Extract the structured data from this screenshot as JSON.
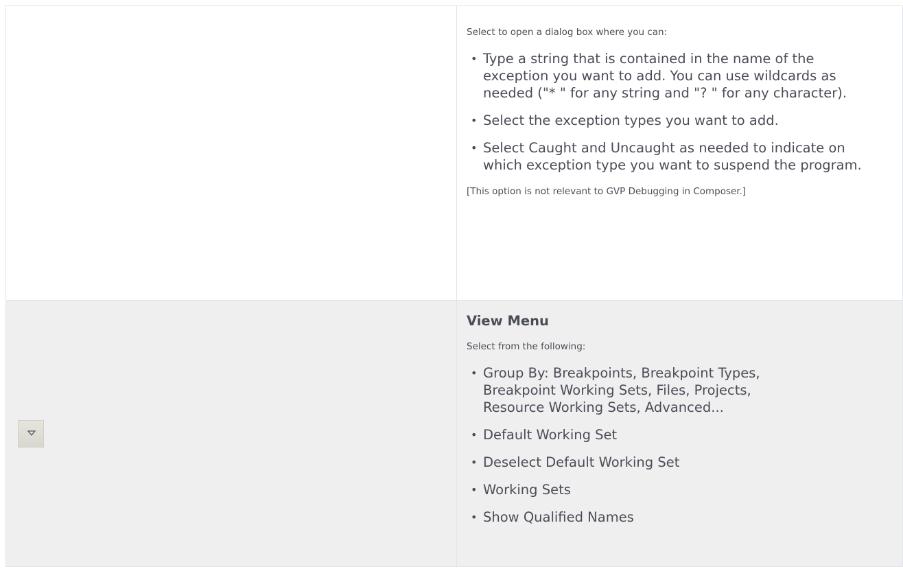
{
  "rows": [
    {
      "intro": "Select to open a dialog box where you can:",
      "bullets": [
        "Type a string that is contained in the name of the exception you want to add. You can use wildcards as needed (\"* \" for any string and \"? \" for any character).",
        "Select the exception types you want to add.",
        "Select Caught and Uncaught as needed to indicate on which exception type you want to suspend the program."
      ],
      "note": "[This option is not relevant to GVP Debugging in Composer.]"
    },
    {
      "icon": "view-menu-dropdown-icon",
      "heading": "View Menu",
      "intro": "Select from the following:",
      "bullets": [
        "Group By:  Breakpoints, Breakpoint Types, Breakpoint Working Sets, Files, Projects, Resource Working Sets, Advanced...",
        "Default Working Set",
        "Deselect Default Working Set",
        "Working Sets",
        "Show Qualified Names"
      ]
    }
  ]
}
